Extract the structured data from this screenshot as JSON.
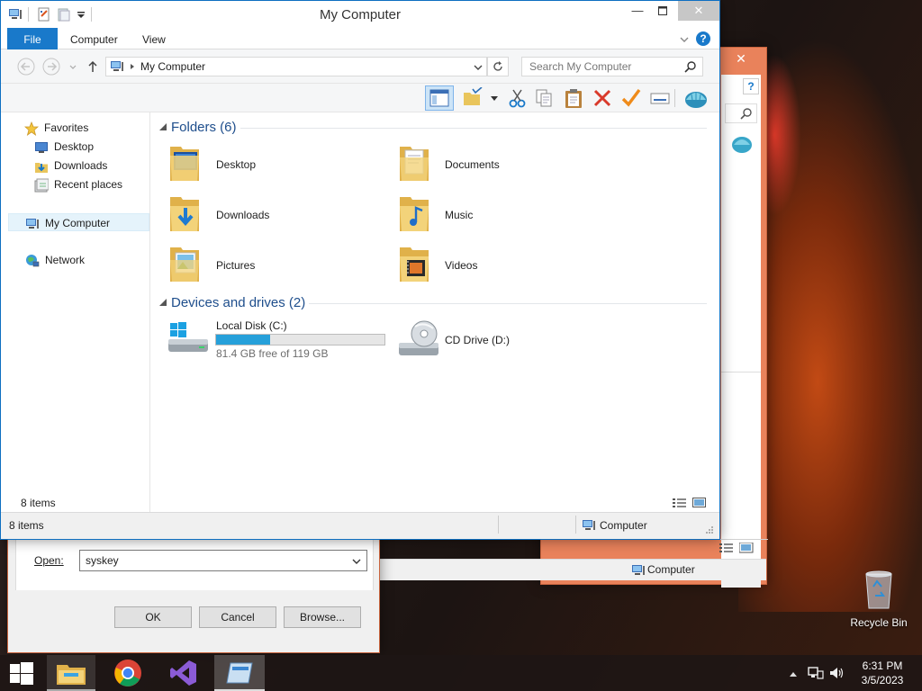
{
  "back_window": {
    "close_glyph": "✕",
    "status_computer": "Computer"
  },
  "run_dialog": {
    "open_label": "Open:",
    "open_value": "syskey",
    "ok_label": "OK",
    "cancel_label": "Cancel",
    "browse_label": "Browse..."
  },
  "explorer": {
    "title": "My Computer",
    "ribbon_tabs": [
      "File",
      "Computer",
      "View"
    ],
    "address_text": "My Computer",
    "search_placeholder": "Search My Computer",
    "nav": {
      "favorites": "Favorites",
      "desktop": "Desktop",
      "downloads": "Downloads",
      "recent": "Recent places",
      "my_computer": "My Computer",
      "network": "Network"
    },
    "groups": {
      "folders": "Folders (6)",
      "devices": "Devices and drives (2)"
    },
    "folders": [
      "Desktop",
      "Documents",
      "Downloads",
      "Music",
      "Pictures",
      "Videos"
    ],
    "drives": {
      "c_label": "Local Disk (C:)",
      "c_free": "81.4 GB free of 119 GB",
      "c_used_fraction": 0.32,
      "d_label": "CD Drive (D:)"
    },
    "items_count": "8 items",
    "status_items": "8 items",
    "status_location": "Computer"
  },
  "desktop": {
    "recycle_bin": "Recycle Bin"
  },
  "taskbar": {
    "time": "6:31 PM",
    "date": "3/5/2023"
  },
  "colors": {
    "accent": "#1979ca",
    "drive_bar": "#26a0da",
    "back_window": "#e9825b"
  }
}
